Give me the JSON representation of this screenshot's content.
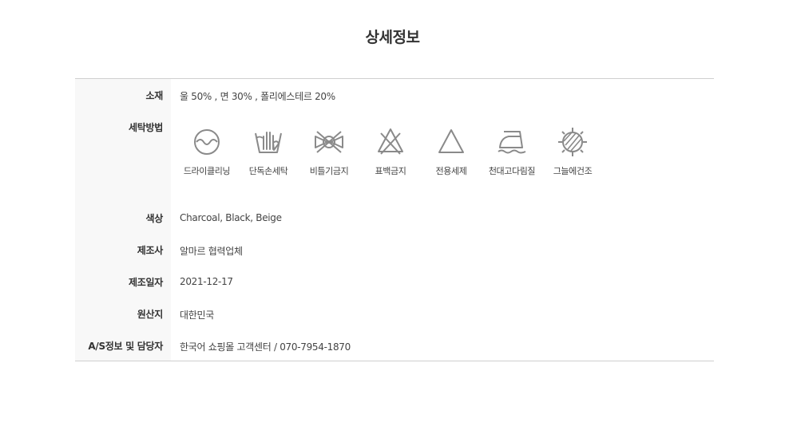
{
  "page": {
    "title": "상세정보"
  },
  "details": {
    "material": {
      "label": "소재",
      "value": "울 50% , 면 30% , 폴리에스테르 20%"
    },
    "washing": {
      "label": "세탁방법",
      "icons": [
        {
          "icon": "dry-clean-icon",
          "caption": "드라이클리닝"
        },
        {
          "icon": "hand-wash-icon",
          "caption": "단독손세탁"
        },
        {
          "icon": "no-wring-icon",
          "caption": "비틀기금지"
        },
        {
          "icon": "no-bleach-icon",
          "caption": "표백금지"
        },
        {
          "icon": "neutral-detergent-icon",
          "caption": "전용세제"
        },
        {
          "icon": "iron-with-cloth-icon",
          "caption": "천대고다림질"
        },
        {
          "icon": "shade-dry-icon",
          "caption": "그늘에건조"
        }
      ]
    },
    "color": {
      "label": "색상",
      "value": "Charcoal, Black, Beige"
    },
    "manufacturer": {
      "label": "제조사",
      "value": "알마르 협력업체"
    },
    "manufacture_date": {
      "label": "제조일자",
      "value": "2021-12-17"
    },
    "origin": {
      "label": "원산지",
      "value": "대한민국"
    },
    "as_contact": {
      "label": "A/S정보 및 담당자",
      "value": "한국어 쇼핑몰 고객센터 / 070-7954-1870"
    }
  },
  "colors": {
    "label_background": "#f8f8f8",
    "border": "#cfcfcf",
    "icon_stroke": "#8a8a8a",
    "text": "#333333"
  }
}
